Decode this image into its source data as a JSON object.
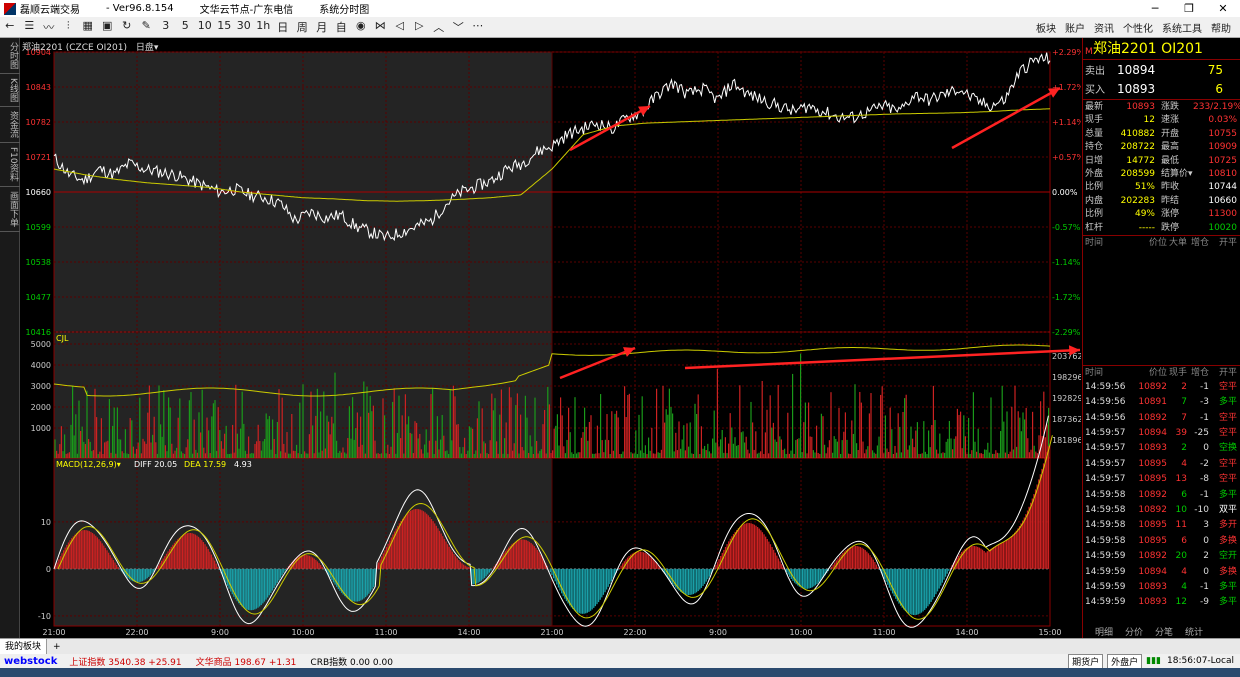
{
  "titlebar": {
    "app_title": "磊顺云端交易",
    "version": "- Ver96.8.154",
    "node": "文华云节点-广东电信",
    "window": "系统分时图"
  },
  "toolbar": {
    "icons": [
      "back-arrow-icon",
      "list-icon",
      "line-chart-icon",
      "kline-icon",
      "grid-icon",
      "calendar-icon",
      "refresh-icon",
      "drawing-icon",
      "3",
      "5",
      "10",
      "15",
      "30",
      "1h",
      "日",
      "周",
      "月",
      "自定",
      "eye-icon",
      "hourglass-icon",
      "left-icon",
      "right-icon",
      "up-icon",
      "down-icon",
      "more-icon"
    ],
    "labels": [
      "←",
      "☰",
      "〰",
      "⫶",
      "▦",
      "▣",
      "↻",
      "✎",
      "3",
      "5",
      "10",
      "15",
      "30",
      "1h",
      "日",
      "周",
      "月",
      "自",
      "◉",
      "⋈",
      "◁",
      "▷",
      "︿",
      "﹀",
      "⋯"
    ],
    "menu": [
      "板块",
      "账户",
      "资讯",
      "个性化",
      "系统工具",
      "帮助"
    ]
  },
  "left_tabs": [
    "分时图",
    "K线图",
    "资金流",
    "F10资料",
    "画面下单"
  ],
  "chart_header": {
    "symbol": "郑油2201 (CZCE OI201)",
    "period": "日盘▾",
    "vol_label": "CJL",
    "macd_label": "MACD(12,26,9)▾",
    "diff": "DIFF 20.05",
    "dea": "DEA 17.59",
    "macd_val": "4.93"
  },
  "chart_data": {
    "type": "line",
    "price_axis": [
      "10904",
      "10843",
      "10782",
      "10721",
      "10660",
      "10599",
      "10538",
      "10477",
      "10416"
    ],
    "pct_axis": [
      "+2.29%",
      "+1.72%",
      "+1.14%",
      "+0.57%",
      "0.00%",
      "-0.57%",
      "-1.14%",
      "-1.72%",
      "-2.29%"
    ],
    "vol_axis": [
      "5000",
      "4000",
      "3000",
      "2000",
      "1000"
    ],
    "oi_axis": [
      "203762",
      "198296",
      "192829",
      "187362",
      "181896"
    ],
    "macd_axis": [
      "10",
      "0",
      "-10"
    ],
    "time_axis": [
      "21:00",
      "22:00",
      "9:00",
      "10:00",
      "11:00",
      "14:00",
      "21:00",
      "22:00",
      "9:00",
      "10:00",
      "11:00",
      "14:00",
      "15:00"
    ],
    "prev_settle": 10660,
    "ylim": [
      10416,
      10904
    ],
    "price_path": [
      10720,
      10690,
      10680,
      10700,
      10690,
      10710,
      10700,
      10695,
      10690,
      10680,
      10670,
      10660,
      10665,
      10655,
      10650,
      10640,
      10610,
      10625,
      10615,
      10620,
      10600,
      10590,
      10580,
      10590,
      10600,
      10610,
      10640,
      10660,
      10670,
      10680,
      10700,
      10710,
      10730,
      10740,
      10760,
      10770,
      10780,
      10770,
      10790,
      10800,
      10830,
      10850,
      10830,
      10840,
      10820,
      10850,
      10830,
      10820,
      10810,
      10800,
      10810,
      10800,
      10790,
      10790,
      10800,
      10810,
      10800,
      10830,
      10820,
      10830,
      10840,
      10820,
      10810,
      10820,
      10870,
      10890,
      10893
    ],
    "avg_path": [
      10700,
      10690,
      10682,
      10676,
      10672,
      10668,
      10660,
      10655,
      10650,
      10648,
      10645,
      10644,
      10645,
      10647,
      10650,
      10655,
      10700,
      10760,
      10775,
      10780,
      10782,
      10784,
      10786,
      10788,
      10790,
      10792,
      10794,
      10796,
      10797,
      10798,
      10800,
      10803,
      10805
    ],
    "volumes_seed": 7,
    "macd_seed": 3
  },
  "quote": {
    "title": "郑油2201  OI201",
    "m": "M",
    "ask_label": "卖出",
    "ask_price": "10894",
    "ask_vol": "75",
    "bid_label": "买入",
    "bid_price": "10893",
    "bid_vol": "6",
    "rows": [
      {
        "k": "最新",
        "v": "10893",
        "vc": "#f33",
        "k2": "涨跌",
        "v2": "233/2.19%",
        "v2c": "#f33"
      },
      {
        "k": "现手",
        "v": "12",
        "vc": "#ff0",
        "k2": "速涨",
        "v2": "0.03%",
        "v2c": "#f33"
      },
      {
        "k": "总量",
        "v": "410882",
        "vc": "#ff0",
        "k2": "开盘",
        "v2": "10755",
        "v2c": "#f33"
      },
      {
        "k": "持仓",
        "v": "208722",
        "vc": "#ff0",
        "k2": "最高",
        "v2": "10909",
        "v2c": "#f33"
      },
      {
        "k": "日增",
        "v": "14772",
        "vc": "#ff0",
        "k2": "最低",
        "v2": "10725",
        "v2c": "#f33"
      },
      {
        "k": "外盘",
        "v": "208599",
        "vc": "#ff0",
        "k2": "结算价▾",
        "v2": "10810",
        "v2c": "#f33"
      },
      {
        "k": "比例",
        "v": "51%",
        "vc": "#ff0",
        "k2": "昨收",
        "v2": "10744",
        "v2c": "#fff"
      },
      {
        "k": "内盘",
        "v": "202283",
        "vc": "#ff0",
        "k2": "昨结",
        "v2": "10660",
        "v2c": "#fff"
      },
      {
        "k": "比例",
        "v": "49%",
        "vc": "#ff0",
        "k2": "涨停",
        "v2": "11300",
        "v2c": "#f33"
      },
      {
        "k": "杠杆",
        "v": "-----",
        "vc": "#ff0",
        "k2": "跌停",
        "v2": "10020",
        "v2c": "#0c0"
      }
    ],
    "big_hdr": [
      "时间",
      "价位",
      "大单",
      "增仓",
      "开平"
    ],
    "tick_hdr": [
      "时间",
      "价位",
      "现手",
      "增仓",
      "开平"
    ],
    "ticks": [
      {
        "t": "14:59:56",
        "p": "10892",
        "n": "2",
        "nc": "#f33",
        "d": "-1",
        "o": "空平",
        "oc": "#f33"
      },
      {
        "t": "14:59:56",
        "p": "10891",
        "n": "7",
        "nc": "#0c0",
        "d": "-3",
        "o": "多平",
        "oc": "#0c0"
      },
      {
        "t": "14:59:56",
        "p": "10892",
        "n": "7",
        "nc": "#f33",
        "d": "-1",
        "o": "空平",
        "oc": "#f33"
      },
      {
        "t": "14:59:57",
        "p": "10894",
        "n": "39",
        "nc": "#f33",
        "d": "-25",
        "o": "空平",
        "oc": "#f33"
      },
      {
        "t": "14:59:57",
        "p": "10893",
        "n": "2",
        "nc": "#0c0",
        "d": "0",
        "o": "空换",
        "oc": "#0c0"
      },
      {
        "t": "14:59:57",
        "p": "10895",
        "n": "4",
        "nc": "#f33",
        "d": "-2",
        "o": "空平",
        "oc": "#f33"
      },
      {
        "t": "14:59:57",
        "p": "10895",
        "n": "13",
        "nc": "#f33",
        "d": "-8",
        "o": "空平",
        "oc": "#f33"
      },
      {
        "t": "14:59:58",
        "p": "10892",
        "n": "6",
        "nc": "#0c0",
        "d": "-1",
        "o": "多平",
        "oc": "#0c0"
      },
      {
        "t": "14:59:58",
        "p": "10892",
        "n": "10",
        "nc": "#0c0",
        "d": "-10",
        "o": "双平",
        "oc": "#fff"
      },
      {
        "t": "14:59:58",
        "p": "10895",
        "n": "11",
        "nc": "#f33",
        "d": "3",
        "o": "多开",
        "oc": "#f33"
      },
      {
        "t": "14:59:58",
        "p": "10895",
        "n": "6",
        "nc": "#f33",
        "d": "0",
        "o": "多换",
        "oc": "#f33"
      },
      {
        "t": "14:59:59",
        "p": "10892",
        "n": "20",
        "nc": "#0c0",
        "d": "2",
        "o": "空开",
        "oc": "#0c0"
      },
      {
        "t": "14:59:59",
        "p": "10894",
        "n": "4",
        "nc": "#f33",
        "d": "0",
        "o": "多换",
        "oc": "#f33"
      },
      {
        "t": "14:59:59",
        "p": "10893",
        "n": "4",
        "nc": "#0c0",
        "d": "-1",
        "o": "多平",
        "oc": "#0c0"
      },
      {
        "t": "14:59:59",
        "p": "10893",
        "n": "12",
        "nc": "#0c0",
        "d": "-9",
        "o": "多平",
        "oc": "#0c0"
      }
    ],
    "tabs": [
      "明细",
      "分价",
      "分笔",
      "统计"
    ]
  },
  "bottom": {
    "tab": "我的板块",
    "plus": "+",
    "logo": "webstock",
    "idx1": "上证指数  3540.38  +25.91",
    "idx2": "文华商品  198.67  +1.31",
    "idx3": "CRB指数  0.00  0.00",
    "btn1": "期货户",
    "btn2": "外盘户",
    "time": "18:56:07-Local"
  }
}
